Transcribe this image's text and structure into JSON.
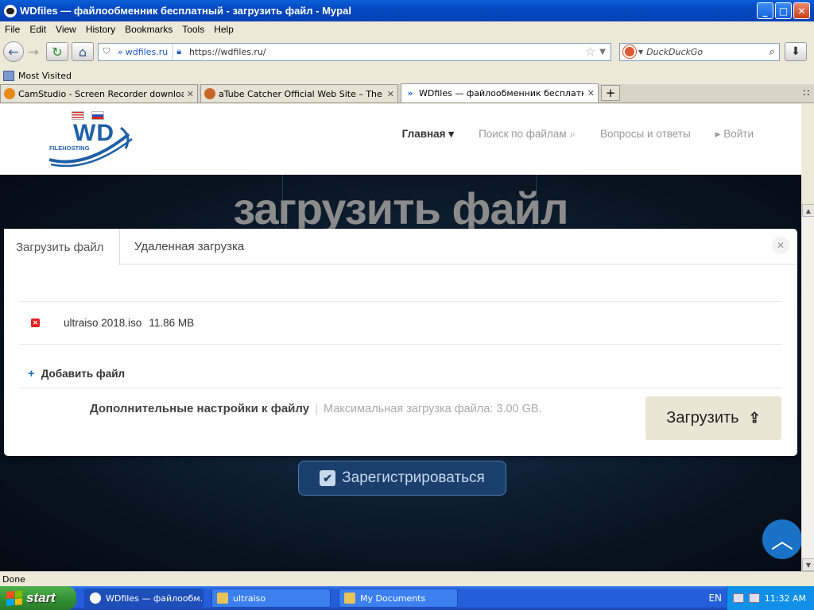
{
  "window": {
    "title": "WDfiles — файлообменник бесплатный - загрузить файл - Mypal",
    "min": "_",
    "max": "□",
    "close": "✕"
  },
  "menu": [
    "File",
    "Edit",
    "View",
    "History",
    "Bookmarks",
    "Tools",
    "Help"
  ],
  "navbar": {
    "site_label": "wdfiles.ru",
    "url": "https://wdfiles.ru/",
    "search_placeholder": "DuckDuckGo"
  },
  "bookmarks": {
    "most_visited": "Most Visited"
  },
  "tabs": [
    {
      "title": "CamStudio - Screen Recorder download |...",
      "favicon_color": "#e8891a"
    },
    {
      "title": "aTube Catcher Official Web Site – The be...",
      "favicon_color": "#c8672a"
    },
    {
      "title": "WDfiles — файлообменник бесплатный...",
      "favicon_color": "#1a5fd0"
    }
  ],
  "site": {
    "logo_text": "WD",
    "logo_sub": "FILEHOSTING",
    "nav": {
      "home": "Главная ▾",
      "search": "Поиск по файлам",
      "faq": "Вопросы и ответы",
      "login": "Войти"
    },
    "hero_title": "загрузить файл",
    "register_button": "Зарегистрироваться"
  },
  "modal": {
    "tab_upload": "Загрузить файл",
    "tab_remote": "Удаленная загрузка",
    "file": {
      "name": "ultraiso 2018.iso",
      "size": "11.86 MB"
    },
    "add_file": "Добавить файл",
    "advanced": "Дополнительные настройки к файлу",
    "separator": "|",
    "max_upload": "Максимальная загрузка файла: 3.00 GB.",
    "upload_button": "Загрузить"
  },
  "status": "Done",
  "taskbar": {
    "start": "start",
    "tasks": [
      {
        "label": "WDfiles — файлообм...",
        "icon_color": "#333"
      },
      {
        "label": "ultraiso",
        "icon_color": "#e8c35a"
      },
      {
        "label": "My Documents",
        "icon_color": "#e8c35a"
      }
    ],
    "keyboard": "EN",
    "time": "11:32 AM"
  },
  "colors": {
    "title_blue": "#0449c2",
    "site_accent": "#1a72c7",
    "hero_dark": "#08131f",
    "taskbar_blue": "#245edb",
    "start_green": "#318f31"
  }
}
